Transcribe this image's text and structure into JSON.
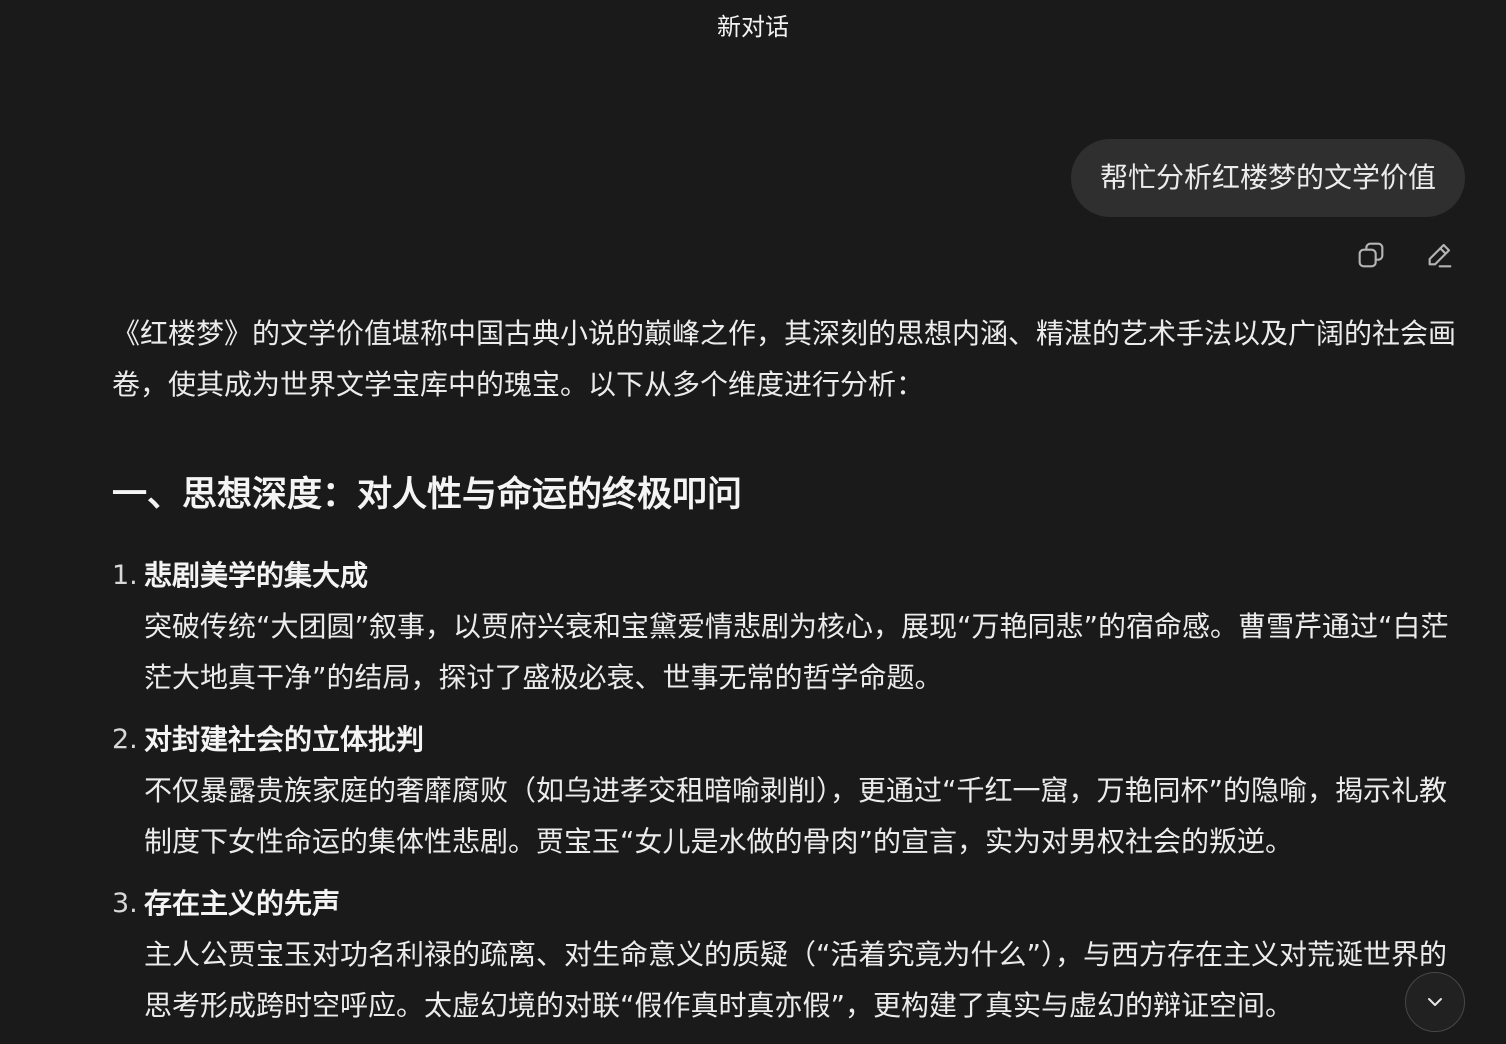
{
  "header": {
    "title": "新对话"
  },
  "user_message": {
    "text": "帮忙分析红楼梦的文学价值"
  },
  "message_actions": {
    "copy_icon": "copy-icon",
    "edit_icon": "edit-pencil-icon"
  },
  "answer": {
    "intro": "《红楼梦》的文学价值堪称中国古典小说的巅峰之作，其深刻的思想内涵、精湛的艺术手法以及广阔的社会画卷，使其成为世界文学宝库中的瑰宝。以下从多个维度进行分析：",
    "section_heading": "一、思想深度：对人性与命运的终极叩问",
    "points": [
      {
        "num": "1.",
        "title": "悲剧美学的集大成",
        "body": "突破传统“大团圆”叙事，以贾府兴衰和宝黛爱情悲剧为核心，展现“万艳同悲”的宿命感。曹雪芹通过“白茫茫大地真干净”的结局，探讨了盛极必衰、世事无常的哲学命题。"
      },
      {
        "num": "2.",
        "title": "对封建社会的立体批判",
        "body": "不仅暴露贵族家庭的奢靡腐败（如乌进孝交租暗喻剥削），更通过“千红一窟，万艳同杯”的隐喻，揭示礼教制度下女性命运的集体性悲剧。贾宝玉“女儿是水做的骨肉”的宣言，实为对男权社会的叛逆。"
      },
      {
        "num": "3.",
        "title": "存在主义的先声",
        "body": "主人公贾宝玉对功名利禄的疏离、对生命意义的质疑（“活着究竟为什么”），与西方存在主义对荒诞世界的思考形成跨时空呼应。太虚幻境的对联“假作真时真亦假”，更构建了真实与虚幻的辩证空间。"
      }
    ]
  },
  "scroll_button": {
    "icon": "chevron-down-icon"
  }
}
